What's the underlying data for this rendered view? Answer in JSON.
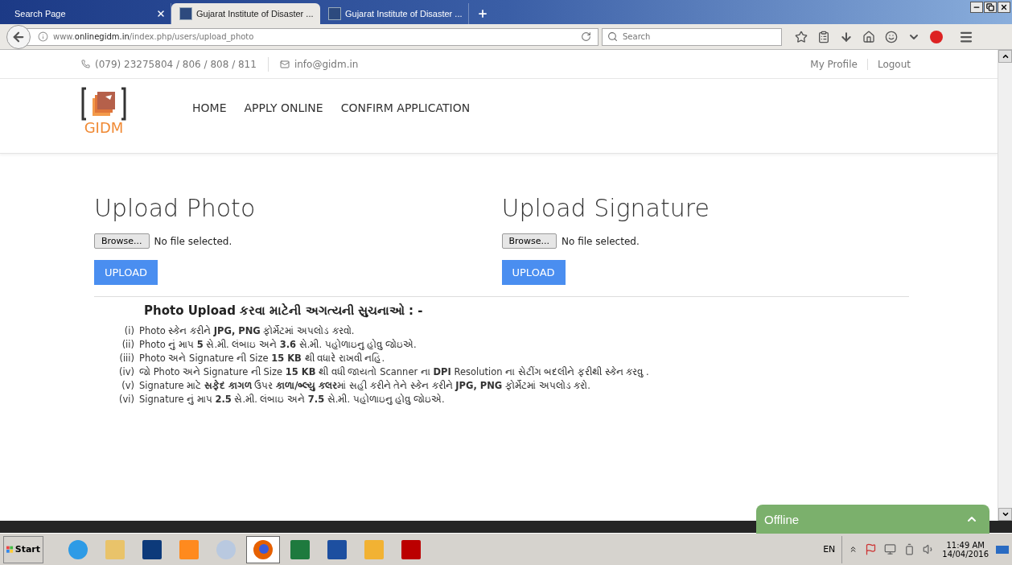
{
  "browser": {
    "tabs": [
      {
        "title": "Search Page",
        "selected": false,
        "favicon": false
      },
      {
        "title": "Gujarat Institute of Disaster ...",
        "selected": true,
        "favicon": true
      },
      {
        "title": "Gujarat Institute of Disaster ...",
        "selected": false,
        "favicon": true
      }
    ],
    "url": "www.**onlinegidm.in**/index.php/users/upload_photo",
    "search": {
      "placeholder": "Search"
    }
  },
  "topbar": {
    "phone": "(079) 23275804 / 806 / 808 / 811",
    "email": "info@gidm.in",
    "account_links": [
      "My Profile",
      "Logout"
    ]
  },
  "header": {
    "logo": "GIDM",
    "nav": [
      "HOME",
      "APPLY ONLINE",
      "CONFIRM APPLICATION"
    ]
  },
  "upload_sections": [
    {
      "heading": "Upload Photo",
      "browse": "Browse...",
      "file_status": "No file selected.",
      "submit": "UPLOAD"
    },
    {
      "heading": "Upload Signature",
      "browse": "Browse...",
      "file_status": "No file selected.",
      "submit": "UPLOAD"
    }
  ],
  "instructions": {
    "heading": "Photo Upload કરવા માટેની અગત્યની સુચનાઓ : -",
    "items": [
      {
        "marker": "(i)",
        "text": "Photo સ્કેન કરીને **JPG, PNG** ફોર્મેટમાં અપલોડ કરવો."
      },
      {
        "marker": "(ii)",
        "text": "Photo નું માપ **5** સે.મી. લંબાઇ અને **3.6** સે.મી. પહોળાઇનુ હોવુ જોઇએ."
      },
      {
        "marker": "(iii)",
        "text": "Photo અને Signature ની Size **15 KB** થી વધારે રાખવી નહિ."
      },
      {
        "marker": "(iv)",
        "text": "જો Photo અને Signature ની Size **15 KB** થી વધી જાયતો Scanner ના **DPI** Resolution ના સેટીંગ બદલીને ફરીથી સ્કેન કરવુ ."
      },
      {
        "marker": "(v)",
        "text": "Signature માટે **સફેદ કાગળ** ઉપર **કાળા/બ્લ્યુ કલર**માં સહી કરીને તેને સ્કેન કરીને **JPG, PNG** ફોર્મેટમાં અપલોડ કરો."
      },
      {
        "marker": "(vi)",
        "text": "Signature નું માપ **2.5** સે.મી. લંબાઇ અને **7.5** સે.મી. પહોળાઇનુ હોવુ જોઇએ."
      }
    ]
  },
  "chat": {
    "label": "Offline"
  },
  "taskbar": {
    "start": "Start",
    "apps": [
      {
        "kind": "ie",
        "selected": false
      },
      {
        "kind": "folder",
        "selected": false
      },
      {
        "kind": "photoshop",
        "selected": false
      },
      {
        "kind": "media",
        "selected": false
      },
      {
        "kind": "paint",
        "selected": false
      },
      {
        "kind": "firefox",
        "selected": true
      },
      {
        "kind": "excel",
        "selected": false
      },
      {
        "kind": "word",
        "selected": false
      },
      {
        "kind": "outlook",
        "selected": false
      },
      {
        "kind": "filezilla",
        "selected": false
      }
    ],
    "language": "EN",
    "time": "11:49 AM",
    "date": "14/04/2016"
  }
}
